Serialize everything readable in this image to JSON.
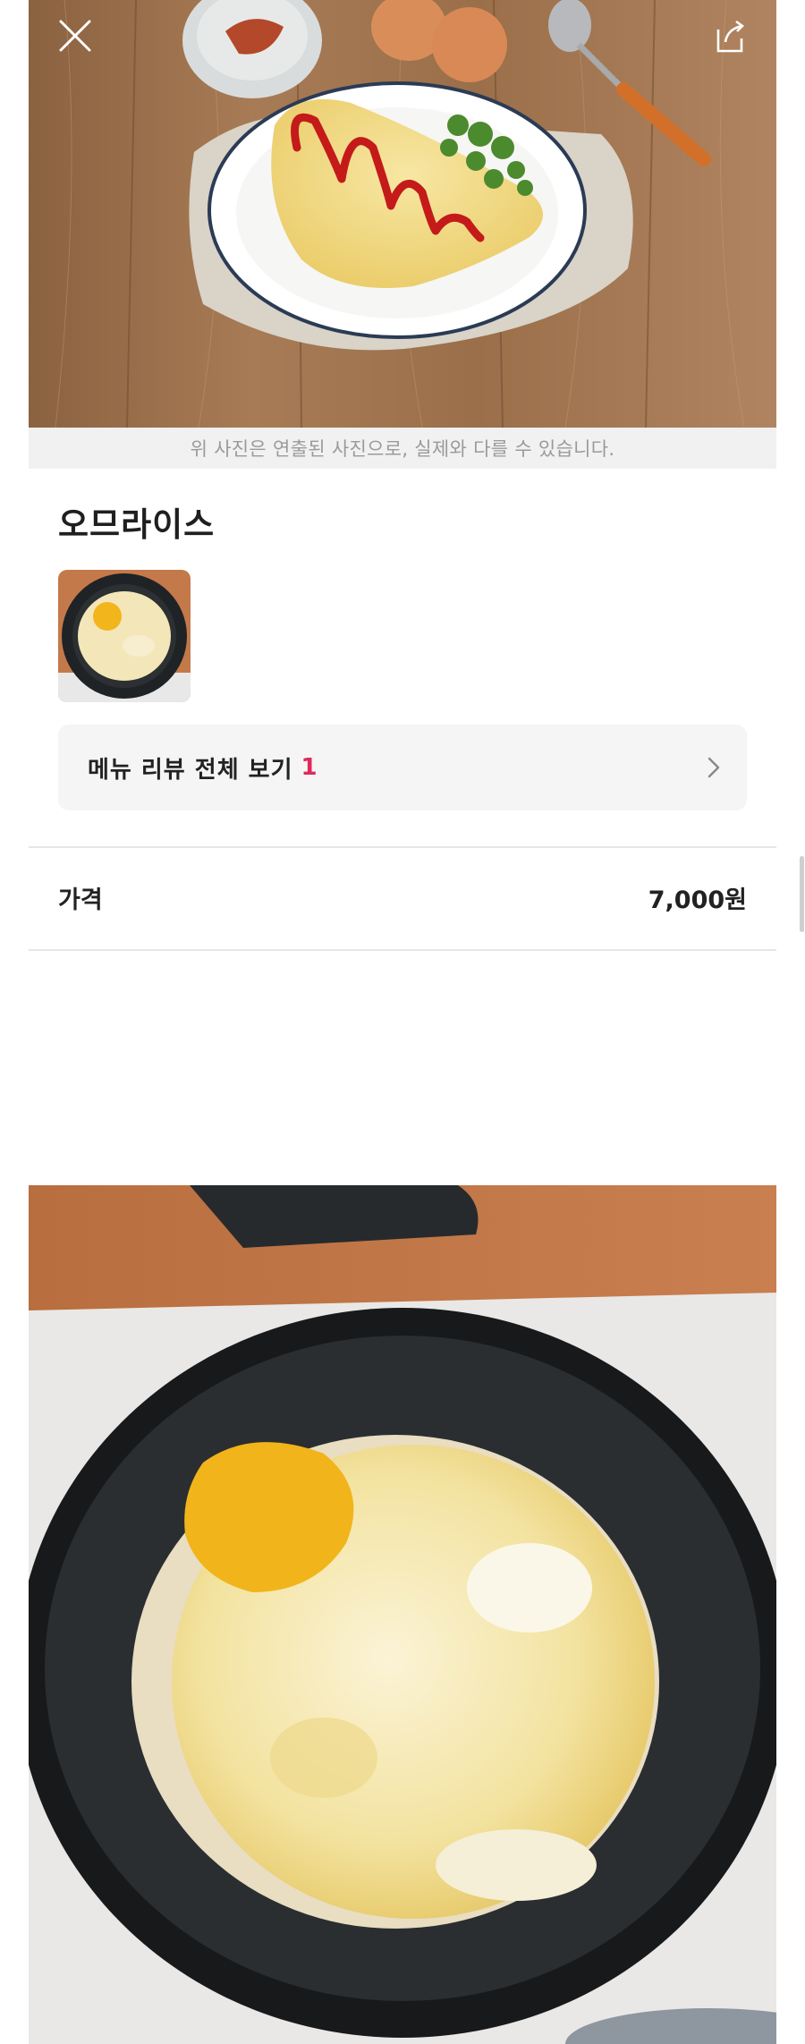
{
  "hero": {
    "caption": "위 사진은 연출된 사진으로, 실제와 다를 수 있습니다."
  },
  "menu": {
    "title": "오므라이스",
    "review_link_label": "메뉴 리뷰 전체 보기",
    "review_count": "1"
  },
  "price": {
    "label": "가격",
    "value": "7,000원"
  },
  "colors": {
    "accent": "#e1285a",
    "caption_bg": "#f1f1f1",
    "review_box_bg": "#f5f5f5"
  }
}
